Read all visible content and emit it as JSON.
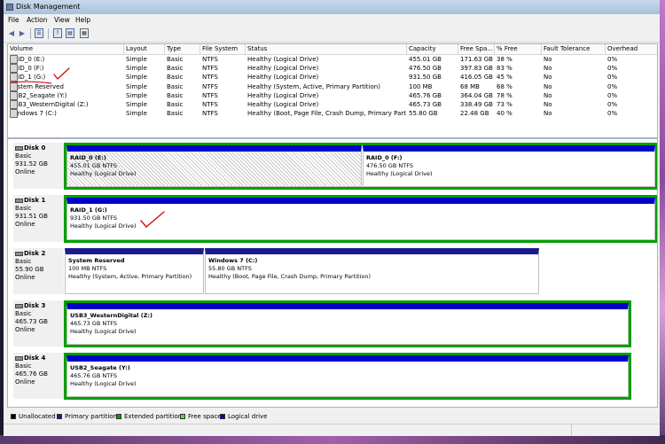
{
  "window": {
    "title": "Disk Management"
  },
  "menu": [
    "File",
    "Action",
    "View",
    "Help"
  ],
  "toolbar": {
    "back_icon": "back-arrow-icon",
    "forward_icon": "forward-arrow-icon",
    "help_glyph": "?",
    "properties_glyph": "▦"
  },
  "volume_list": {
    "columns": [
      "Volume",
      "Layout",
      "Type",
      "File System",
      "Status",
      "Capacity",
      "Free Spa...",
      "% Free",
      "Fault Tolerance",
      "Overhead"
    ],
    "rows": [
      [
        "RAID_0 (E:)",
        "Simple",
        "Basic",
        "NTFS",
        "Healthy (Logical Drive)",
        "455.01 GB",
        "171.63 GB",
        "38 %",
        "No",
        "0%"
      ],
      [
        "RAID_0 (F:)",
        "Simple",
        "Basic",
        "NTFS",
        "Healthy (Logical Drive)",
        "476.50 GB",
        "397.83 GB",
        "83 %",
        "No",
        "0%"
      ],
      [
        "RAID_1 (G:)",
        "Simple",
        "Basic",
        "NTFS",
        "Healthy (Logical Drive)",
        "931.50 GB",
        "416.05 GB",
        "45 %",
        "No",
        "0%"
      ],
      [
        "System Reserved",
        "Simple",
        "Basic",
        "NTFS",
        "Healthy (System, Active, Primary Partition)",
        "100 MB",
        "68 MB",
        "68 %",
        "No",
        "0%"
      ],
      [
        "USB2_Seagate (Y:)",
        "Simple",
        "Basic",
        "NTFS",
        "Healthy (Logical Drive)",
        "465.76 GB",
        "364.04 GB",
        "78 %",
        "No",
        "0%"
      ],
      [
        "USB3_WesternDigital (Z:)",
        "Simple",
        "Basic",
        "NTFS",
        "Healthy (Logical Drive)",
        "465.73 GB",
        "338.49 GB",
        "73 %",
        "No",
        "0%"
      ],
      [
        "Windows 7 (C:)",
        "Simple",
        "Basic",
        "NTFS",
        "Healthy (Boot, Page File, Crash Dump, Primary Partitio...",
        "55.80 GB",
        "22.48 GB",
        "40 %",
        "No",
        "0%"
      ]
    ]
  },
  "disks": [
    {
      "name": "Disk 0",
      "type": "Basic",
      "size": "931.52 GB",
      "status": "Online",
      "partitions": [
        {
          "name": "RAID_0  (E:)",
          "size": "455.01 GB NTFS",
          "status": "Healthy (Logical Drive)"
        },
        {
          "name": "RAID_0  (F:)",
          "size": "476.50 GB NTFS",
          "status": "Healthy (Logical Drive)"
        }
      ]
    },
    {
      "name": "Disk 1",
      "type": "Basic",
      "size": "931.51 GB",
      "status": "Online",
      "partitions": [
        {
          "name": "RAID_1  (G:)",
          "size": "931.50 GB NTFS",
          "status": "Healthy (Logical Drive)"
        }
      ]
    },
    {
      "name": "Disk 2",
      "type": "Basic",
      "size": "55.90 GB",
      "status": "Online",
      "partitions": [
        {
          "name": "System Reserved",
          "size": "100 MB NTFS",
          "status": "Healthy (System, Active, Primary Partition)"
        },
        {
          "name": "Windows 7  (C:)",
          "size": "55.80 GB NTFS",
          "status": "Healthy (Boot, Page File, Crash Dump, Primary Partition)"
        }
      ]
    },
    {
      "name": "Disk 3",
      "type": "Basic",
      "size": "465.73 GB",
      "status": "Online",
      "partitions": [
        {
          "name": "USB3_WesternDigital  (Z:)",
          "size": "465.73 GB NTFS",
          "status": "Healthy (Logical Drive)"
        }
      ]
    },
    {
      "name": "Disk 4",
      "type": "Basic",
      "size": "465.76 GB",
      "status": "Online",
      "partitions": [
        {
          "name": "USB2_Seagate  (Y:)",
          "size": "465.76 GB NTFS",
          "status": "Healthy (Logical Drive)"
        }
      ]
    }
  ],
  "legend": [
    {
      "label": "Unallocated",
      "color": "#000000"
    },
    {
      "label": "Primary partition",
      "color": "#1c1c8c"
    },
    {
      "label": "Extended partition",
      "color": "#00a000"
    },
    {
      "label": "Free space",
      "color": "#40e040"
    },
    {
      "label": "Logical drive",
      "color": "#0000c8"
    }
  ],
  "colors": {
    "primary": "#1c1c8c",
    "logical": "#0000c8",
    "extended": "#00a000",
    "annotation": "#d01010"
  }
}
